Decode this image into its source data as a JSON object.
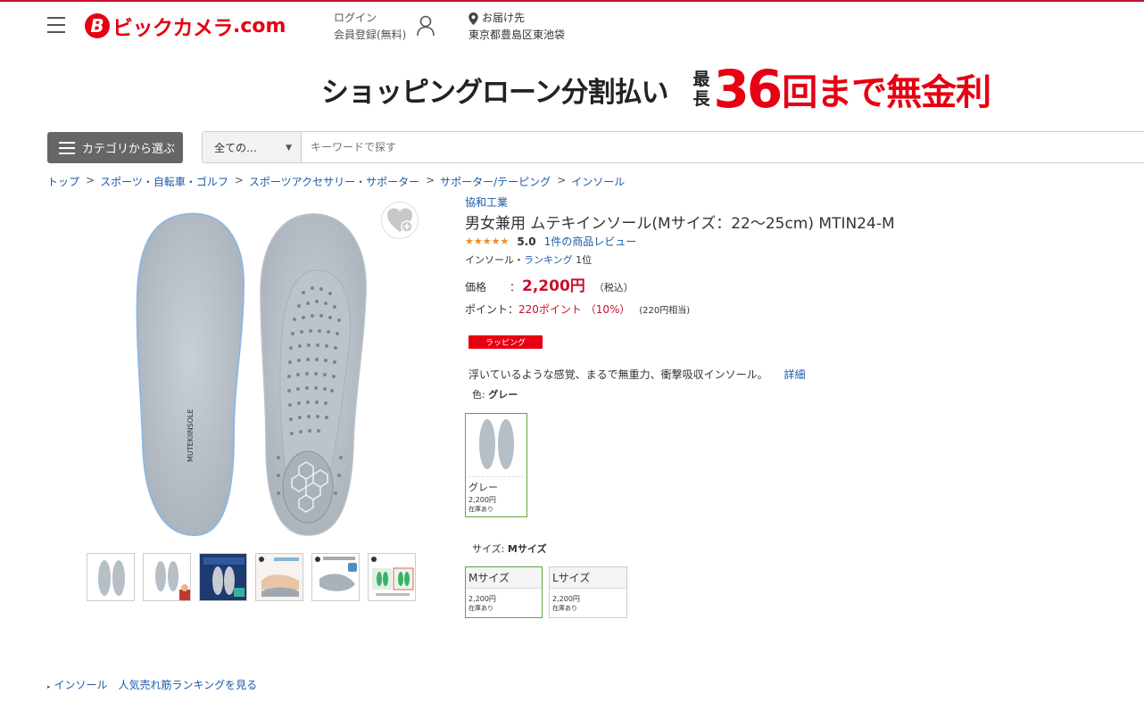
{
  "header": {
    "logo_badge": "B",
    "logo_text": "ビックカメラ",
    "logo_domain": ".com",
    "login_line1": "ログイン",
    "login_line2": "会員登録(無料)",
    "deliver_label": "お届け先",
    "deliver_address": "東京都豊島区東池袋"
  },
  "banner": {
    "text1": "ショッピングローン分割払い",
    "sub1": "最",
    "sub2": "長",
    "big": "36",
    "text2": "回まで無金利"
  },
  "search": {
    "category_button": "カテゴリから選ぶ",
    "select_value": "全ての…",
    "placeholder": "キーワードで探す"
  },
  "breadcrumb": [
    "トップ",
    "スポーツ・自転車・ゴルフ",
    "スポーツアクセサリー・サポーター",
    "サポーター/テーピング",
    "インソール"
  ],
  "product": {
    "maker": "協和工業",
    "title": "男女兼用 ムテキインソール(Mサイズ：22～25cm) MTIN24-M",
    "stars": "★★★★★",
    "score": "5.0",
    "review_link": "1件の商品レビュー",
    "rank_prefix": "インソール・",
    "rank_link": "ランキング",
    "rank_value": "1位",
    "price_label": "価格",
    "price_colon": "：",
    "price": "2,200円",
    "tax": "（税込）",
    "point_label": "ポイント：",
    "point_value": "220ポイント",
    "point_rate": "（10%）",
    "point_equiv": "(220円相当)",
    "wrapping_badge": "ラッピング",
    "description": "浮いているような感覚、まるで無重力、衝撃吸収インソール。",
    "detail_link": "詳細",
    "color_label": "色:",
    "color_value": "グレー",
    "size_label": "サイズ:",
    "size_value": "Mサイズ"
  },
  "color_options": [
    {
      "name": "グレー",
      "price": "2,200円",
      "stock": "在庫あり"
    }
  ],
  "size_options": [
    {
      "name": "Mサイズ",
      "price": "2,200円",
      "stock": "在庫あり"
    },
    {
      "name": "Lサイズ",
      "price": "2,200円",
      "stock": "在庫あり"
    }
  ],
  "ranking_link": "インソール　人気売れ筋ランキングを見る",
  "colors": {
    "brand_red": "#e60012",
    "link_blue": "#1a5aa6",
    "price_red": "#c8102e",
    "selected_green": "#5aaa3a"
  }
}
